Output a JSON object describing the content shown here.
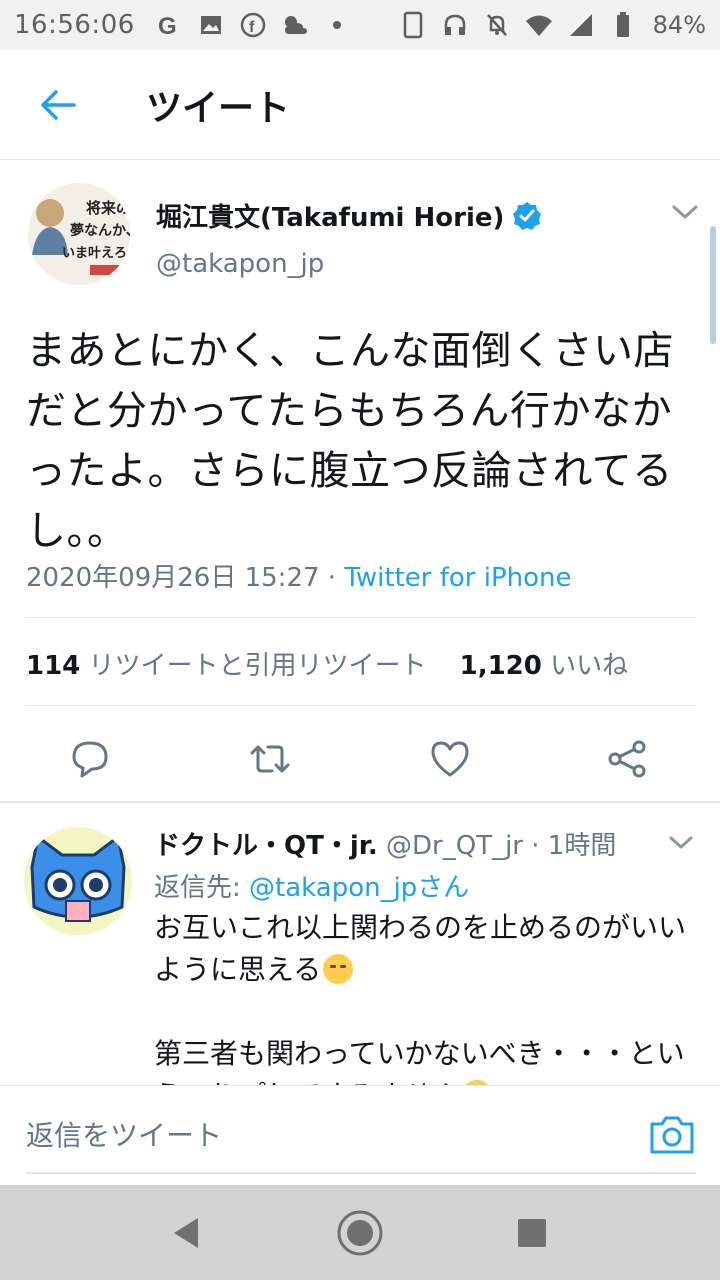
{
  "status_bar": {
    "time": "16:56:06",
    "battery_percent": "84%",
    "left_icons": [
      "google-icon",
      "gallery-icon",
      "facebook-icon",
      "weather-icon",
      "dot-icon"
    ],
    "right_icons": [
      "phone-icon",
      "headphones-icon",
      "mute-icon",
      "wifi-icon",
      "signal-icon",
      "battery-icon"
    ]
  },
  "header": {
    "title": "ツイート"
  },
  "tweet": {
    "author_name": "堀江貴文(Takafumi Horie)",
    "handle": "@takapon_jp",
    "text": "まあとにかく、こんな面倒くさい店だと分かってたらもちろん行かなかったよ。さらに腹立つ反論されてるし。。",
    "timestamp": "2020年09月26日 15:27",
    "separator": " · ",
    "source": "Twitter for iPhone",
    "retweet_count": "114",
    "retweet_label": "リツイートと引用リツイート",
    "like_count": "1,120",
    "like_label": "いいね",
    "avatar_text": [
      "将来の",
      "夢なんか、",
      "いま叶えろ。"
    ]
  },
  "reply": {
    "author_name": "ドクトル・QT・jr.",
    "handle": "@Dr_QT_jr",
    "time_ago": "· 1時間",
    "reply_prefix": "返信先: ",
    "reply_to_link": "@takapon_jpさん",
    "text_line1": "お互いこれ以上関わるのを止めるのがいいように思える",
    "text_line2": "第三者も関わっていかないべき・・・というつりプしてすみません"
  },
  "compose": {
    "placeholder": "返信をツイート"
  },
  "colors": {
    "accent": "#1da1f2",
    "secondary_text": "#657786",
    "primary_text": "#14171a",
    "divider": "#e1e8ed"
  }
}
